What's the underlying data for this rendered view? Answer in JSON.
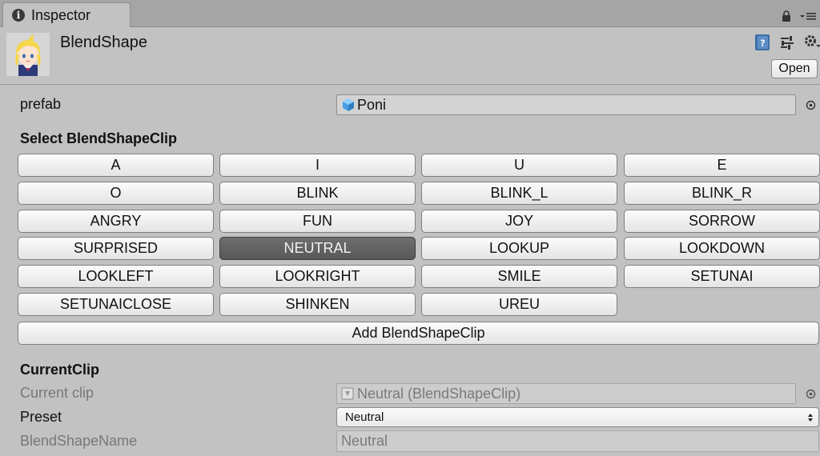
{
  "tab": {
    "title": "Inspector"
  },
  "header": {
    "title": "BlendShape",
    "open_label": "Open"
  },
  "prefab": {
    "label": "prefab",
    "value": "Poni"
  },
  "select_section": {
    "title": "Select BlendShapeClip"
  },
  "clips": [
    "A",
    "I",
    "U",
    "E",
    "O",
    "BLINK",
    "BLINK_L",
    "BLINK_R",
    "ANGRY",
    "FUN",
    "JOY",
    "SORROW",
    "SURPRISED",
    "NEUTRAL",
    "LOOKUP",
    "LOOKDOWN",
    "LOOKLEFT",
    "LOOKRIGHT",
    "SMILE",
    "SETUNAI",
    "SETUNAICLOSE",
    "SHINKEN",
    "UREU"
  ],
  "selected_clip": "NEUTRAL",
  "add_button_label": "Add BlendShapeClip",
  "current_clip_section": {
    "title": "CurrentClip",
    "current_clip_label": "Current clip",
    "current_clip_value": "Neutral (BlendShapeClip)",
    "preset_label": "Preset",
    "preset_value": "Neutral",
    "blendshape_name_label": "BlendShapeName",
    "blendshape_name_value": "Neutral"
  },
  "colors": {
    "panel_bg": "#c2c2c2",
    "tabstrip_bg": "#a5a5a5",
    "active_button": "#5f5f5f",
    "disabled_text": "#787878",
    "prefab_cube": "#4aa0e6"
  }
}
